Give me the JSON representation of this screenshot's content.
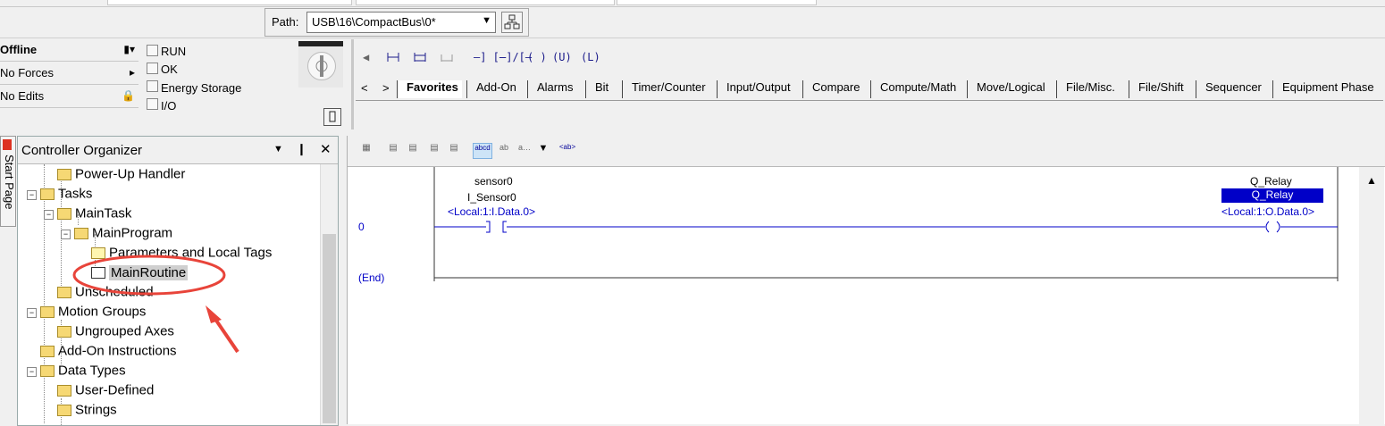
{
  "path_bar": {
    "label": "Path:",
    "value": "USB\\16\\CompactBus\\0*"
  },
  "status": {
    "mode": "Offline",
    "forces": "No Forces",
    "edits": "No Edits",
    "indicators": [
      "RUN",
      "OK",
      "Energy Storage",
      "I/O"
    ]
  },
  "palette": {
    "tabs": [
      "Favorites",
      "Add-On",
      "Alarms",
      "Bit",
      "Timer/Counter",
      "Input/Output",
      "Compare",
      "Compute/Math",
      "Move/Logical",
      "File/Misc.",
      "File/Shift",
      "Sequencer",
      "Equipment Phase"
    ],
    "instr": [
      "—] [—",
      "—]/[—",
      "( )",
      "(U)",
      "(L)"
    ]
  },
  "organizer": {
    "title": "Controller Organizer",
    "nodes": [
      "Power-Up Handler",
      "Tasks",
      "MainTask",
      "MainProgram",
      "Parameters and Local Tags",
      "MainRoutine",
      "Unscheduled",
      "Motion Groups",
      "Ungrouped Axes",
      "Add-On Instructions",
      "Data Types",
      "User-Defined",
      "Strings"
    ],
    "pin": "∙",
    "close": "✕",
    "side_tab": "Start Page"
  },
  "editor": {
    "rung0": {
      "number": "0",
      "contact_desc": "sensor0",
      "contact_tag": "I_Sensor0",
      "contact_alias": "<Local:1:I.Data.0>",
      "coil_desc": "Q_Relay",
      "coil_tag": "Q_Relay",
      "coil_alias": "<Local:1:O.Data.0>"
    },
    "end_label": "(End)",
    "toolbar_text": [
      "abcd",
      "a…",
      "<ab>"
    ]
  },
  "colors": {
    "ladder_blue": "#0000c8",
    "annotation_red": "#e8443a"
  }
}
